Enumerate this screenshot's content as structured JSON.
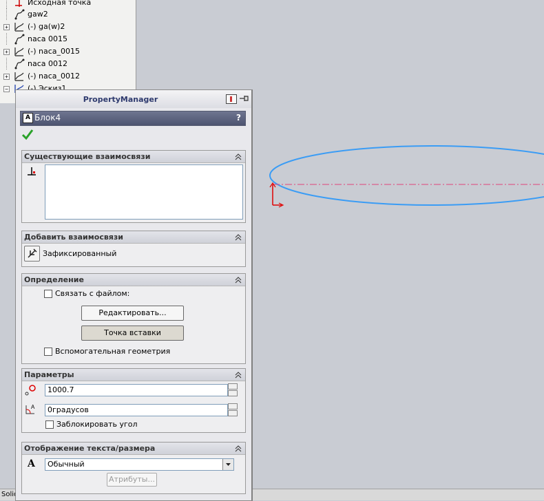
{
  "tree": {
    "items": [
      {
        "label": "Исходная точка",
        "expander": ""
      },
      {
        "label": "gaw2",
        "expander": ""
      },
      {
        "label": "(-) ga(w)2",
        "expander": "+"
      },
      {
        "label": "naca 0015",
        "expander": ""
      },
      {
        "label": "(-) naca_0015",
        "expander": "+"
      },
      {
        "label": "naca 0012",
        "expander": ""
      },
      {
        "label": "(-) naca_0012",
        "expander": "+"
      },
      {
        "label": "(-) Эскиз1",
        "expander": "−"
      }
    ]
  },
  "status": {
    "text": "Solid"
  },
  "pm": {
    "title": "PropertyManager",
    "header": "Блок4",
    "help": "?",
    "existing": {
      "title": "Существующие взаимосвязи"
    },
    "add": {
      "title": "Добавить взаимосвязи",
      "fixed_label": "Зафиксированный"
    },
    "definition": {
      "title": "Определение",
      "link_label": "Связать с файлом:",
      "edit_button": "Редактировать...",
      "insert_button": "Точка вставки",
      "construction_label": "Вспомогательная геометрия"
    },
    "params": {
      "title": "Параметры",
      "scale_value": "1000.7",
      "angle_value": "0градусов",
      "lock_angle_label": "Заблокировать угол"
    },
    "textdisp": {
      "title": "Отображение текста/размера",
      "font_select": "Обычный",
      "attributes_button": "Атрибуты..."
    }
  },
  "colors": {
    "ellipse": "#3a9cf5",
    "centerline": "#e0447a",
    "origin": "#e00000"
  }
}
